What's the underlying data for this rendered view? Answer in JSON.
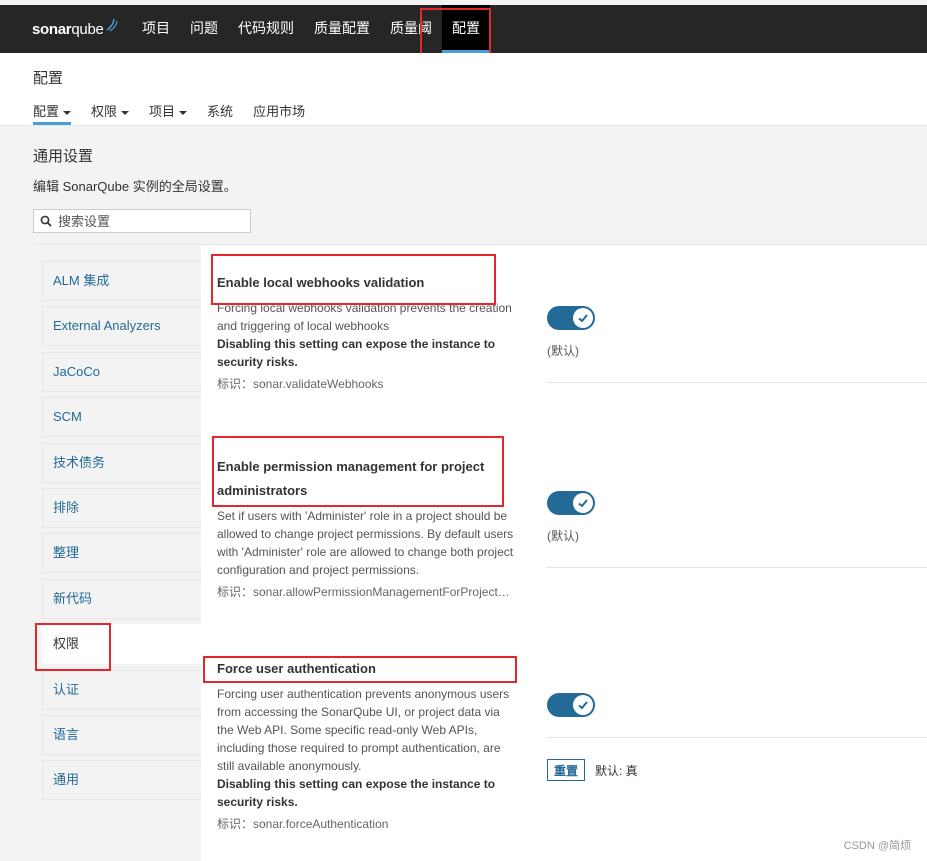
{
  "topbar": {
    "logo": {
      "part1": "sonar",
      "part2": "qube"
    },
    "nav": [
      "项目",
      "问题",
      "代码规则",
      "质量配置",
      "质量阈",
      "配置"
    ],
    "active_index": 5
  },
  "subheader": {
    "title": "配置",
    "tabs": [
      {
        "label": "配置",
        "dropdown": true
      },
      {
        "label": "权限",
        "dropdown": true
      },
      {
        "label": "项目",
        "dropdown": true
      },
      {
        "label": "系统",
        "dropdown": false
      },
      {
        "label": "应用市场",
        "dropdown": false
      }
    ]
  },
  "page": {
    "title": "通用设置",
    "description": "编辑 SonarQube 实例的全局设置。",
    "search_placeholder": "搜索设置"
  },
  "sidebar": {
    "items": [
      "ALM 集成",
      "External Analyzers",
      "JaCoCo",
      "SCM",
      "技术债务",
      "排除",
      "整理",
      "新代码",
      "权限",
      "认证",
      "语言",
      "通用"
    ],
    "active_index": 8
  },
  "settings": [
    {
      "title": "Enable local webhooks validation",
      "description": "Forcing local webhooks validation prevents the creation and triggering of local webhooks",
      "warning": "Disabling this setting can expose the instance to security risks.",
      "key": "标识：sonar.validateWebhooks",
      "toggle_on": true,
      "default_label": "(默认)"
    },
    {
      "title": "Enable permission management for project administrators",
      "description": "Set if users with 'Administer' role in a project should be allowed to change project permissions. By default users with 'Administer' role are allowed to change both project configuration and project permissions.",
      "warning": "",
      "key": "标识：sonar.allowPermissionManagementForProjectAdmins",
      "toggle_on": true,
      "default_label": "(默认)"
    },
    {
      "title": "Force user authentication",
      "description": "Forcing user authentication prevents anonymous users from accessing the SonarQube UI, or project data via the Web API. Some specific read-only Web APIs, including those required to prompt authentication, are still available anonymously.",
      "warning": "Disabling this setting can expose the instance to security risks.",
      "key": "标识：sonar.forceAuthentication",
      "toggle_on": true,
      "reset_label": "重置",
      "default_value": "默认: 真"
    }
  ],
  "watermark": "CSDN @简烦",
  "colors": {
    "accent": "#236a97",
    "topbar": "#262626",
    "highlight_box": "#e5262c",
    "active_underline": "#4b9fd5"
  }
}
